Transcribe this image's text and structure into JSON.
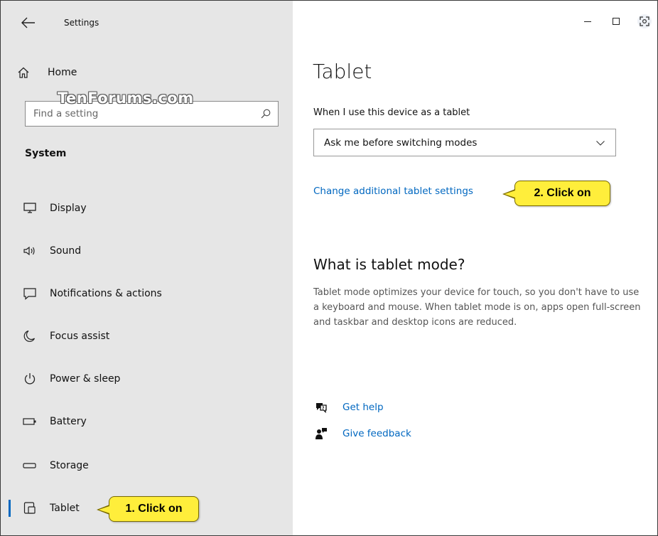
{
  "window": {
    "title": "Settings"
  },
  "sidebar": {
    "home_label": "Home",
    "search_placeholder": "Find a setting",
    "section_label": "System",
    "items": [
      {
        "label": "Display",
        "icon": "monitor-icon"
      },
      {
        "label": "Sound",
        "icon": "speaker-icon"
      },
      {
        "label": "Notifications & actions",
        "icon": "notification-icon"
      },
      {
        "label": "Focus assist",
        "icon": "moon-icon"
      },
      {
        "label": "Power & sleep",
        "icon": "power-icon"
      },
      {
        "label": "Battery",
        "icon": "battery-icon"
      },
      {
        "label": "Storage",
        "icon": "storage-icon"
      },
      {
        "label": "Tablet",
        "icon": "tablet-icon",
        "active": true
      }
    ]
  },
  "watermark": "TenForums.com",
  "main": {
    "title": "Tablet",
    "dropdown_label": "When I use this device as a tablet",
    "dropdown_value": "Ask me before switching modes",
    "additional_link": "Change additional tablet settings",
    "what_is_heading": "What is tablet mode?",
    "what_is_text": "Tablet mode optimizes your device for touch, so you don't have to use a keyboard and mouse. When tablet mode is on, apps open full-screen and taskbar and desktop icons are reduced.",
    "get_help": "Get help",
    "give_feedback": "Give feedback"
  },
  "callouts": {
    "first": "1. Click on",
    "second": "2. Click on"
  },
  "colors": {
    "sidebar_bg": "#e6e6e6",
    "accent": "#0067c0",
    "callout_fill": "#ffee3b"
  }
}
